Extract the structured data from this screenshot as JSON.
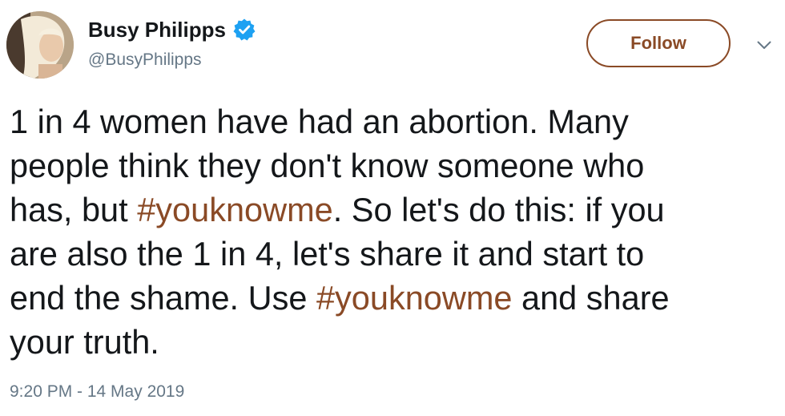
{
  "author": {
    "display_name": "Busy Philipps",
    "handle": "@BusyPhilipps",
    "verified": true
  },
  "actions": {
    "follow_label": "Follow",
    "more_icon": "chevron-down-icon"
  },
  "tweet": {
    "lines": [
      {
        "segments": [
          "1 in 4 women have had an abortion. Many"
        ]
      },
      {
        "segments": [
          "people think they don't know someone who"
        ]
      },
      {
        "segments": [
          "has, but ",
          "#youknowme",
          ". So let's do this: if you"
        ]
      },
      {
        "segments": [
          "are also the 1 in 4, let's share it and start to"
        ]
      },
      {
        "segments": [
          "end the shame. Use ",
          "#youknowme",
          " and share"
        ]
      },
      {
        "segments": [
          "your truth."
        ]
      }
    ],
    "timestamp": "9:20 PM - 14 May 2019"
  },
  "colors": {
    "link_accent": "#8a4a26",
    "verified_badge": "#1da1f2",
    "secondary_text": "#657786",
    "primary_text": "#14171a"
  }
}
